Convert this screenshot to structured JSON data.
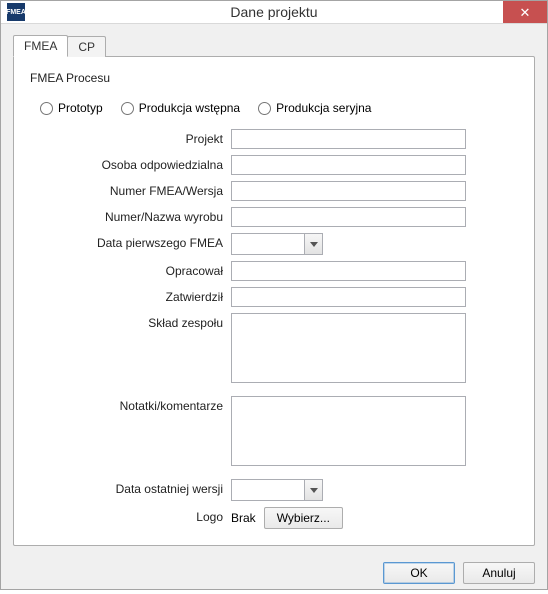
{
  "window": {
    "title": "Dane projektu",
    "app_icon_text": "FMEA"
  },
  "tabs": [
    {
      "label": "FMEA",
      "active": true
    },
    {
      "label": "CP",
      "active": false
    }
  ],
  "section_title": "FMEA Procesu",
  "radios": {
    "r1": "Prototyp",
    "r2": "Produkcja wstępna",
    "r3": "Produkcja seryjna"
  },
  "labels": {
    "projekt": "Projekt",
    "osoba": "Osoba odpowiedzialna",
    "numer_fmea": "Numer FMEA/Wersja",
    "numer_wyrobu": "Numer/Nazwa wyrobu",
    "data_pierwszego": "Data pierwszego FMEA",
    "opracowal": "Opracował",
    "zatwierdzil": "Zatwierdził",
    "sklad": "Skład zespołu",
    "notatki": "Notatki/komentarze",
    "data_ostatniej": "Data ostatniej wersji",
    "logo": "Logo"
  },
  "values": {
    "projekt": "",
    "osoba": "",
    "numer_fmea": "",
    "numer_wyrobu": "",
    "data_pierwszego": "",
    "opracowal": "",
    "zatwierdzil": "",
    "sklad": "",
    "notatki": "",
    "data_ostatniej": ""
  },
  "logo_status": "Brak",
  "buttons": {
    "wybierz": "Wybierz...",
    "ok": "OK",
    "anuluj": "Anuluj"
  }
}
